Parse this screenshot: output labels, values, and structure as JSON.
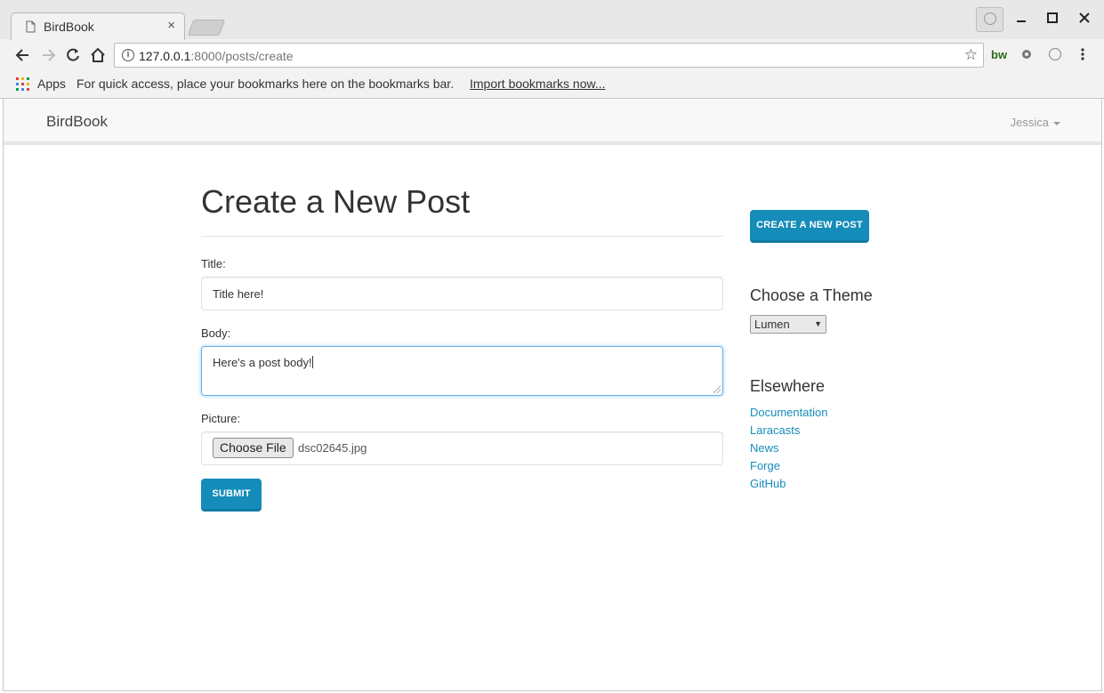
{
  "browser": {
    "tab_title": "BirdBook",
    "tab_close": "×",
    "url_host": "127.0.0.1",
    "url_rest": ":8000/posts/create",
    "apps_label": "Apps",
    "bookmarks_hint": "For quick access, place your bookmarks here on the bookmarks bar.",
    "import_link": "Import bookmarks now...",
    "ext_bw": "bw"
  },
  "navbar": {
    "brand": "BirdBook",
    "user": "Jessica"
  },
  "main": {
    "heading": "Create a New Post",
    "title_label": "Title:",
    "title_value": "Title here!",
    "body_label": "Body:",
    "body_value": "Here's a post body!",
    "picture_label": "Picture:",
    "choose_file_label": "Choose File",
    "file_name": "dsc02645.jpg",
    "submit_label": "SUBMIT"
  },
  "sidebar": {
    "create_button": "CREATE A NEW POST",
    "theme_heading": "Choose a Theme",
    "theme_selected": "Lumen",
    "elsewhere_heading": "Elsewhere",
    "links": [
      "Documentation",
      "Laracasts",
      "News",
      "Forge",
      "GitHub"
    ]
  },
  "colors": {
    "accent": "#158cba",
    "focus": "#66afe9"
  }
}
